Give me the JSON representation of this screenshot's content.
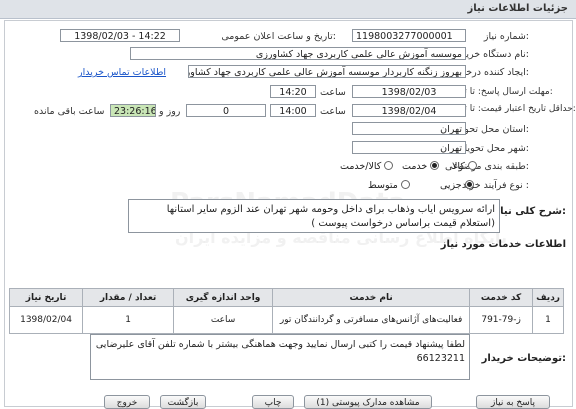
{
  "page": {
    "title": "جزئیات اطلاعات نیاز"
  },
  "form": {
    "need_number": {
      "label": "شماره نیاز:",
      "value": "1198003277000001"
    },
    "announce_datetime": {
      "label": "تاریخ و ساعت اعلان عمومی:",
      "value": "1398/02/03 - 14:22"
    },
    "buyer_org": {
      "label": "نام دستگاه خریدار:",
      "value": "موسسه آموزش عالی علمی کاربردی جهاد کشاورزی"
    },
    "requester": {
      "label": "ایجاد کننده درخواست:",
      "value": "بهروز زنگنه کاربردار موسسه آموزش عالی علمی کاربردی جهاد کشاورزی"
    },
    "contact_link": "اطلاعات تماس خریدار",
    "deadline": {
      "label": "مهلت ارسال پاسخ: تا تاریخ:",
      "date": "1398/02/03",
      "time_label": "ساعت",
      "time": "14:20"
    },
    "validity": {
      "label": "حداقل تاریخ اعتبار قیمت: تا تاریخ:",
      "date": "1398/02/04",
      "time_label": "ساعت",
      "time": "14:00",
      "days": "0",
      "days_label": "روز و",
      "remaining": "23:26:16",
      "remaining_label": "ساعت باقی مانده"
    },
    "province": {
      "label": "استان محل تحویل:",
      "value": "تهران"
    },
    "city": {
      "label": "شهر محل تحویل:",
      "value": "تهران"
    },
    "category": {
      "label": "طبقه بندی موضوعی:",
      "options": [
        {
          "label": "کالا",
          "checked": false
        },
        {
          "label": "خدمت",
          "checked": true
        },
        {
          "label": "کالا/خدمت",
          "checked": false
        }
      ]
    },
    "process_type": {
      "label": "نوع فرآیند خرید :",
      "options": [
        {
          "label": "جزیی",
          "checked": true
        },
        {
          "label": "متوسط",
          "checked": false
        }
      ]
    }
  },
  "general_description": {
    "label": "شرح کلی نیاز:",
    "text": "ارائه سرویس ایاب وذهاب برای داخل وحومه شهر تهران عند الزوم سایر استانها (استعلام قیمت براساس درخواست پیوست )"
  },
  "services": {
    "title": "اطلاعات خدمات مورد نیاز",
    "columns": [
      "ردیف",
      "کد خدمت",
      "نام خدمت",
      "واحد اندازه گیری",
      "تعداد / مقدار",
      "تاریخ نیاز"
    ],
    "rows": [
      {
        "index": "1",
        "code": "ز-79-791",
        "name": "فعالیت‌های آژانس‌های مسافرتی و گردانندگان تور",
        "unit": "ساعت",
        "qty": "1",
        "date": "1398/02/04"
      }
    ]
  },
  "buyer_notes": {
    "label": "توضیحات خریدار:",
    "text": "لطفا پیشنهاد قیمت را کتبی ارسال نمایید وجهت هماهنگی بیشتر با شماره تلفن  آقای علیرضایی 66123211"
  },
  "buttons": {
    "reply": "پاسخ به نیاز",
    "attachments": "مشاهده مدارک پیوستی (1)",
    "print": "چاپ",
    "back": "بازگشت",
    "exit": "خروج"
  },
  "watermark": {
    "brand": "ParsNamadData",
    "line": "پایگاه اطلاع رسانی مناقصه و مزایده ایران"
  },
  "colors": {
    "header_bg": "#dfe3e8",
    "remaining_bg": "#c9e6b6",
    "link": "#1a55c9"
  }
}
